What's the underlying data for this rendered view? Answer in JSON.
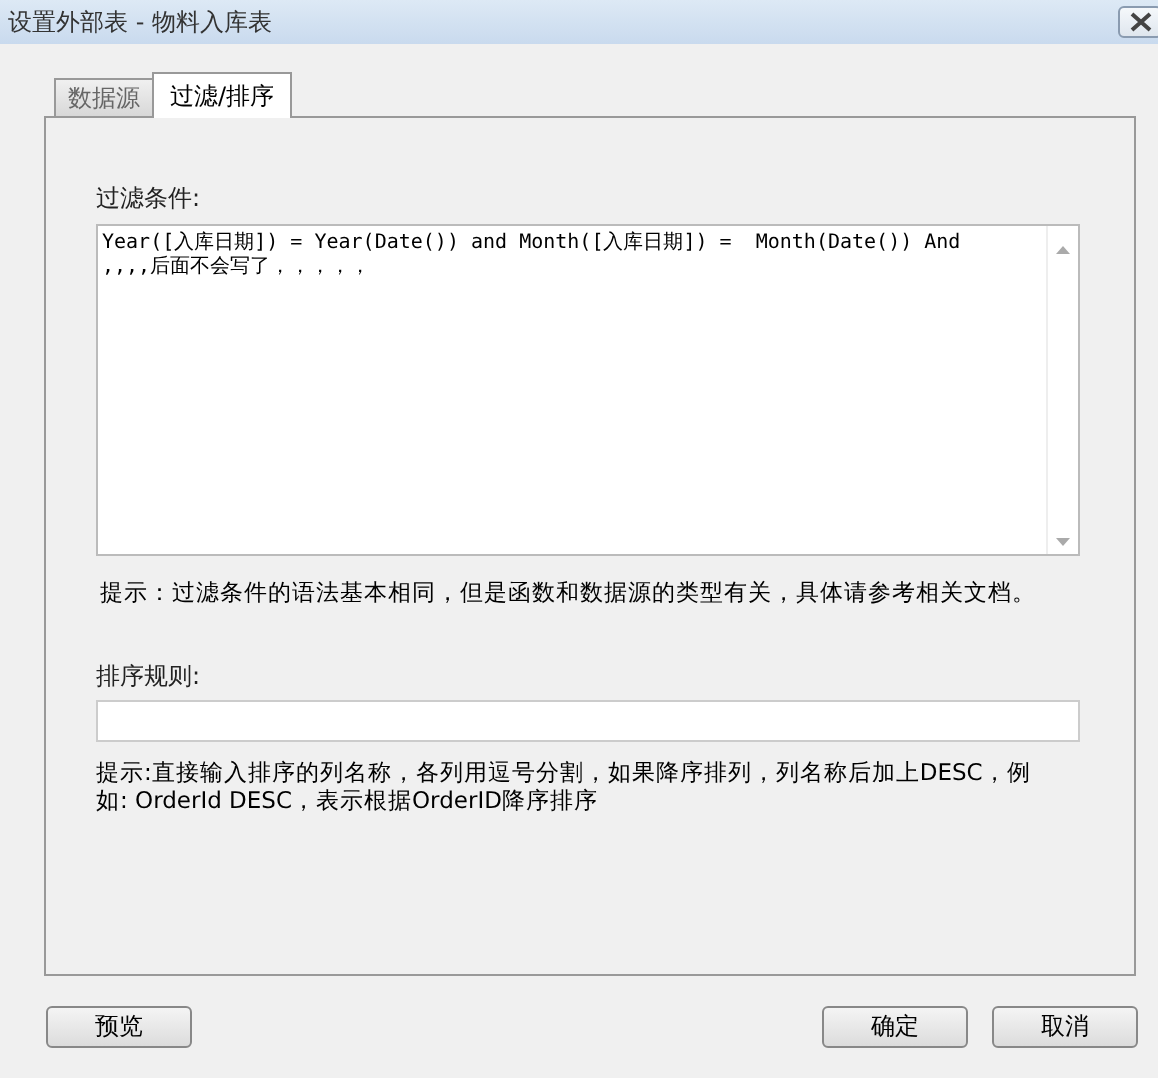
{
  "window": {
    "title": "设置外部表 - 物料入库表"
  },
  "tabs": [
    {
      "label": "数据源",
      "selected": false
    },
    {
      "label": "过滤/排序",
      "selected": true
    }
  ],
  "filter": {
    "label": "过滤条件:",
    "value": "Year([入库日期]) = Year(Date()) and Month([入库日期]) =  Month(Date()) And\n,,,,后面不会写了，，，，，",
    "hint": "提示：过滤条件的语法基本相同，但是函数和数据源的类型有关，具体请参考相关文档。"
  },
  "sort": {
    "label": "排序规则:",
    "hint": "提示:直接输入排序的列名称，各列用逗号分割，如果降序排列，列名称后加上DESC，例如:  OrderId DESC，表示根据OrderID降序排序"
  },
  "buttons": [
    {
      "label": "预览",
      "kind": "left"
    },
    {
      "label": "确定",
      "kind": "right"
    },
    {
      "label": "取消",
      "kind": "right"
    }
  ]
}
